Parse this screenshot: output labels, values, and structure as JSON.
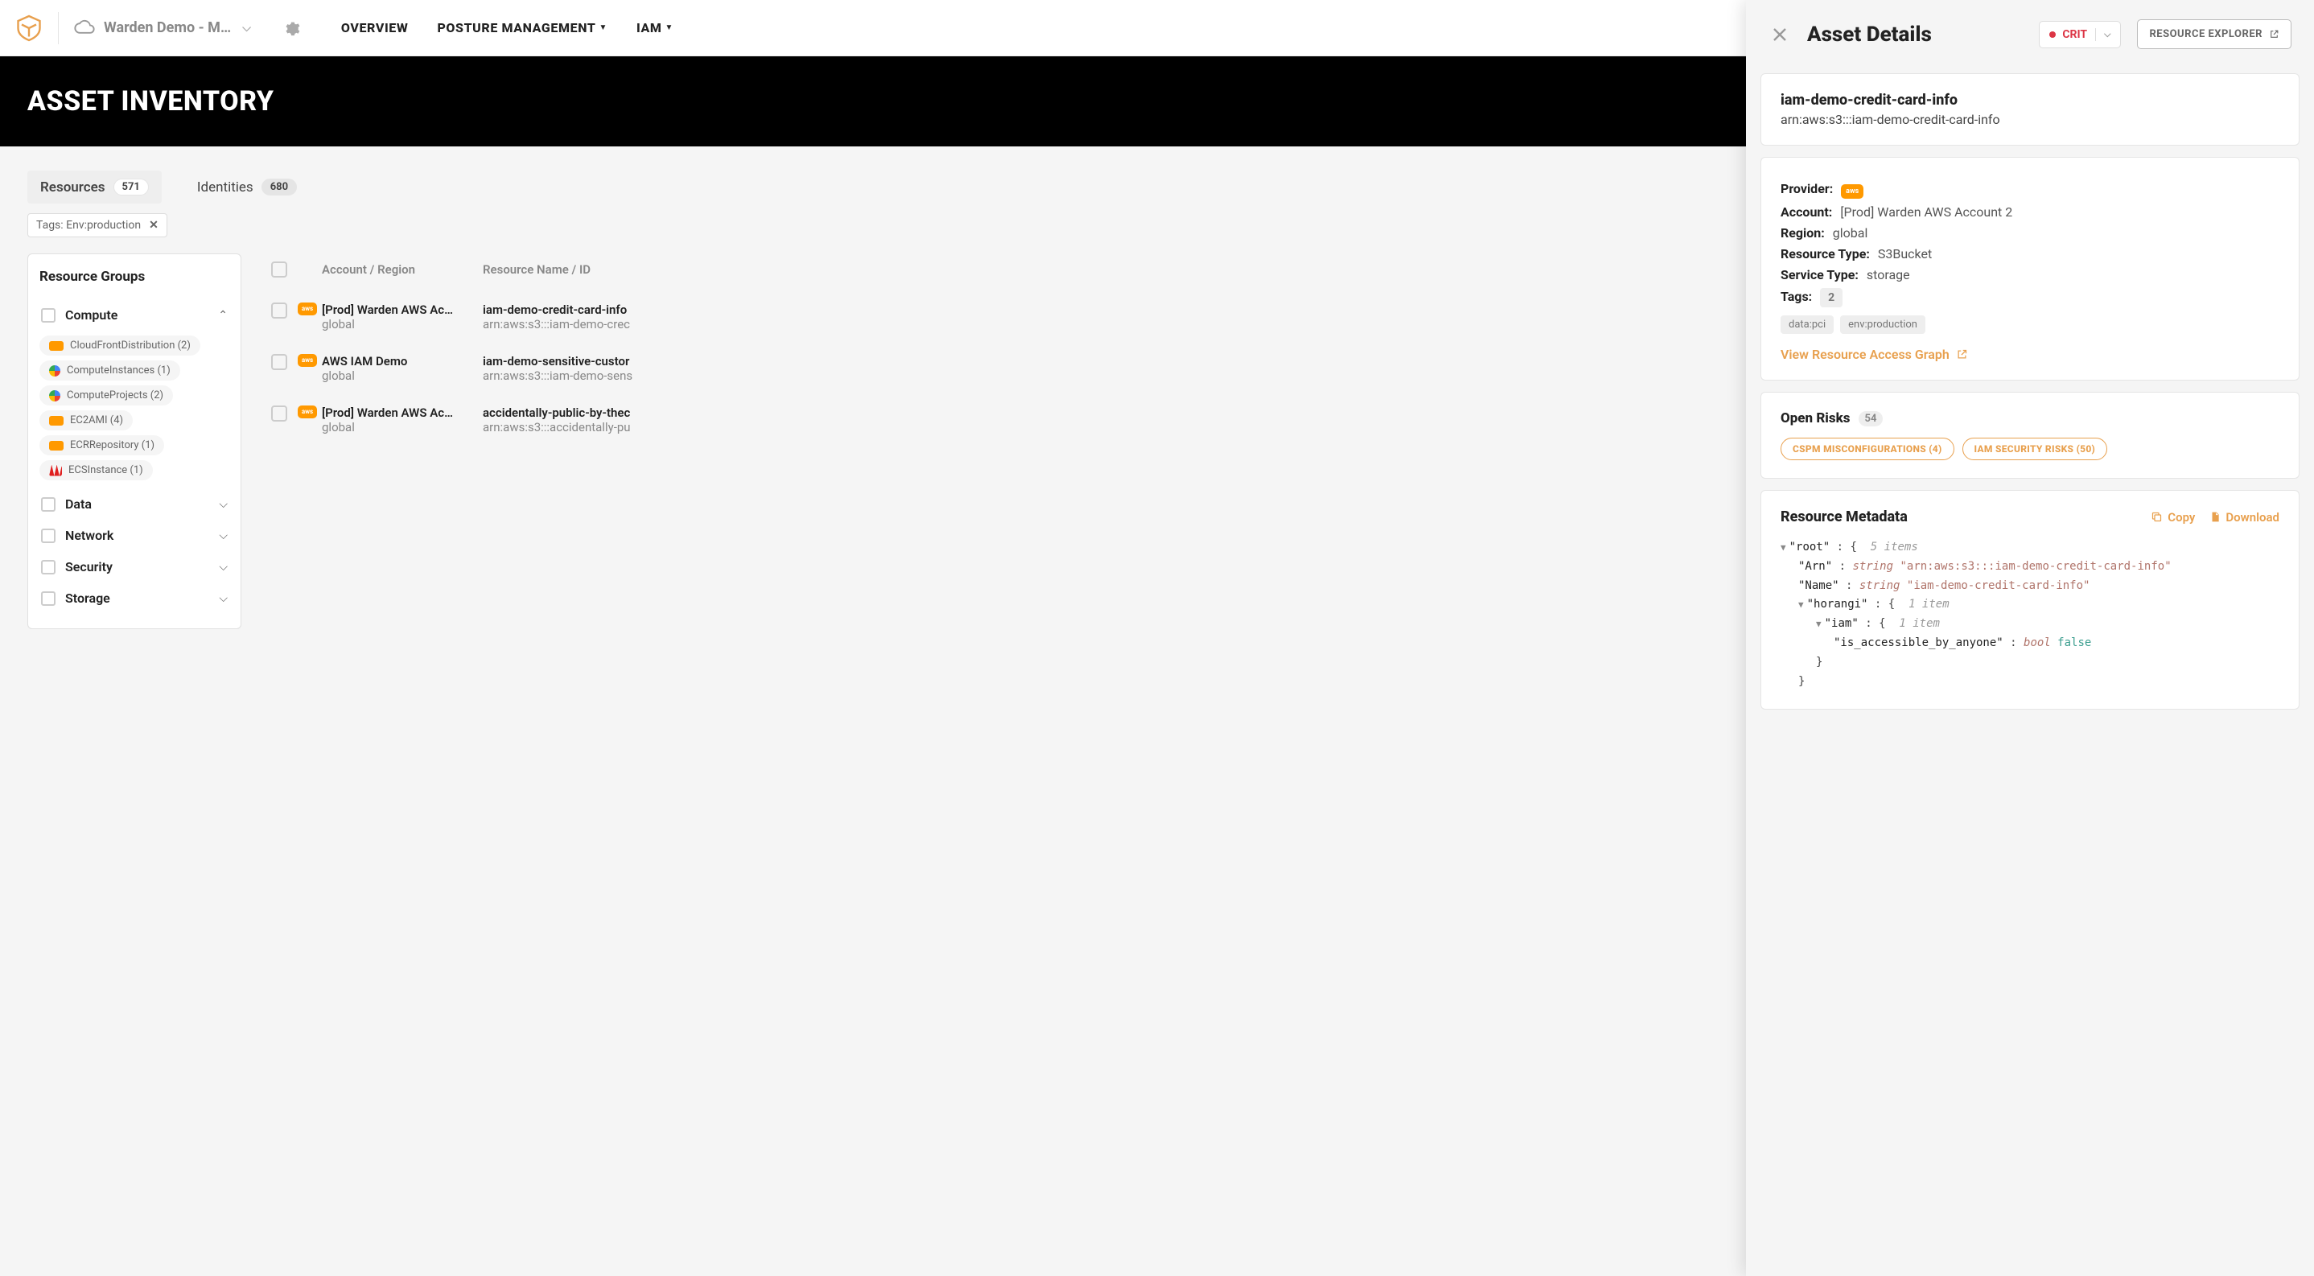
{
  "header": {
    "org_label": "Warden Demo - M…",
    "nav": {
      "overview": "OVERVIEW",
      "posture": "POSTURE MANAGEMENT",
      "iam": "IAM"
    }
  },
  "page_title": "ASSET INVENTORY",
  "tabs": {
    "resources": {
      "label": "Resources",
      "count": "571"
    },
    "identities": {
      "label": "Identities",
      "count": "680"
    }
  },
  "filter_chip": "Tags: Env:production",
  "sidebar": {
    "title": "Resource Groups",
    "groups": {
      "compute": {
        "label": "Compute",
        "items": [
          {
            "label": "CloudFrontDistribution (2)",
            "prov": "aws"
          },
          {
            "label": "ComputeInstances (1)",
            "prov": "gcp"
          },
          {
            "label": "ComputeProjects (2)",
            "prov": "gcp"
          },
          {
            "label": "EC2AMI (4)",
            "prov": "aws"
          },
          {
            "label": "ECRRepository (1)",
            "prov": "aws"
          },
          {
            "label": "ECSInstance (1)",
            "prov": "hw"
          }
        ]
      },
      "data": {
        "label": "Data"
      },
      "network": {
        "label": "Network"
      },
      "security": {
        "label": "Security"
      },
      "storage": {
        "label": "Storage"
      }
    }
  },
  "table": {
    "head": {
      "account": "Account / Region",
      "name": "Resource Name / ID"
    },
    "rows": [
      {
        "account": "[Prod] Warden AWS Ac…",
        "region": "global",
        "name": "iam-demo-credit-card-info",
        "id": "arn:aws:s3:::iam-demo-crec"
      },
      {
        "account": "AWS IAM Demo",
        "region": "global",
        "name": "iam-demo-sensitive-custor",
        "id": "arn:aws:s3:::iam-demo-sens"
      },
      {
        "account": "[Prod] Warden AWS Ac…",
        "region": "global",
        "name": "accidentally-public-by-thec",
        "id": "arn:aws:s3:::accidentally-pu"
      }
    ]
  },
  "detail": {
    "title": "Asset Details",
    "crit": "CRIT",
    "resource_explorer": "RESOURCE EXPLORER",
    "name": "iam-demo-credit-card-info",
    "arn": "arn:aws:s3:::iam-demo-credit-card-info",
    "fields": {
      "provider_k": "Provider:",
      "account_k": "Account:",
      "account_v": "[Prod] Warden AWS Account 2",
      "region_k": "Region:",
      "region_v": "global",
      "restype_k": "Resource Type:",
      "restype_v": "S3Bucket",
      "svctype_k": "Service Type:",
      "svctype_v": "storage",
      "tags_k": "Tags:",
      "tags_count": "2"
    },
    "tags": [
      "data:pci",
      "env:production"
    ],
    "graph_link": "View Resource Access Graph",
    "open_risks": {
      "label": "Open Risks",
      "count": "54"
    },
    "risk_badges": [
      "CSPM MISCONFIGURATIONS (4)",
      "IAM SECURITY RISKS (50)"
    ],
    "metadata": {
      "title": "Resource Metadata",
      "copy": "Copy",
      "download": "Download",
      "root_items": "5 items",
      "arn_v": "\"arn:aws:s3:::iam-demo-credit-card-info\"",
      "name_v": "\"iam-demo-credit-card-info\"",
      "horangi_items": "1 item",
      "iam_items": "1 item",
      "is_accessible_key": "\"is_accessible_by_anyone\"",
      "is_accessible_val": "false"
    }
  }
}
